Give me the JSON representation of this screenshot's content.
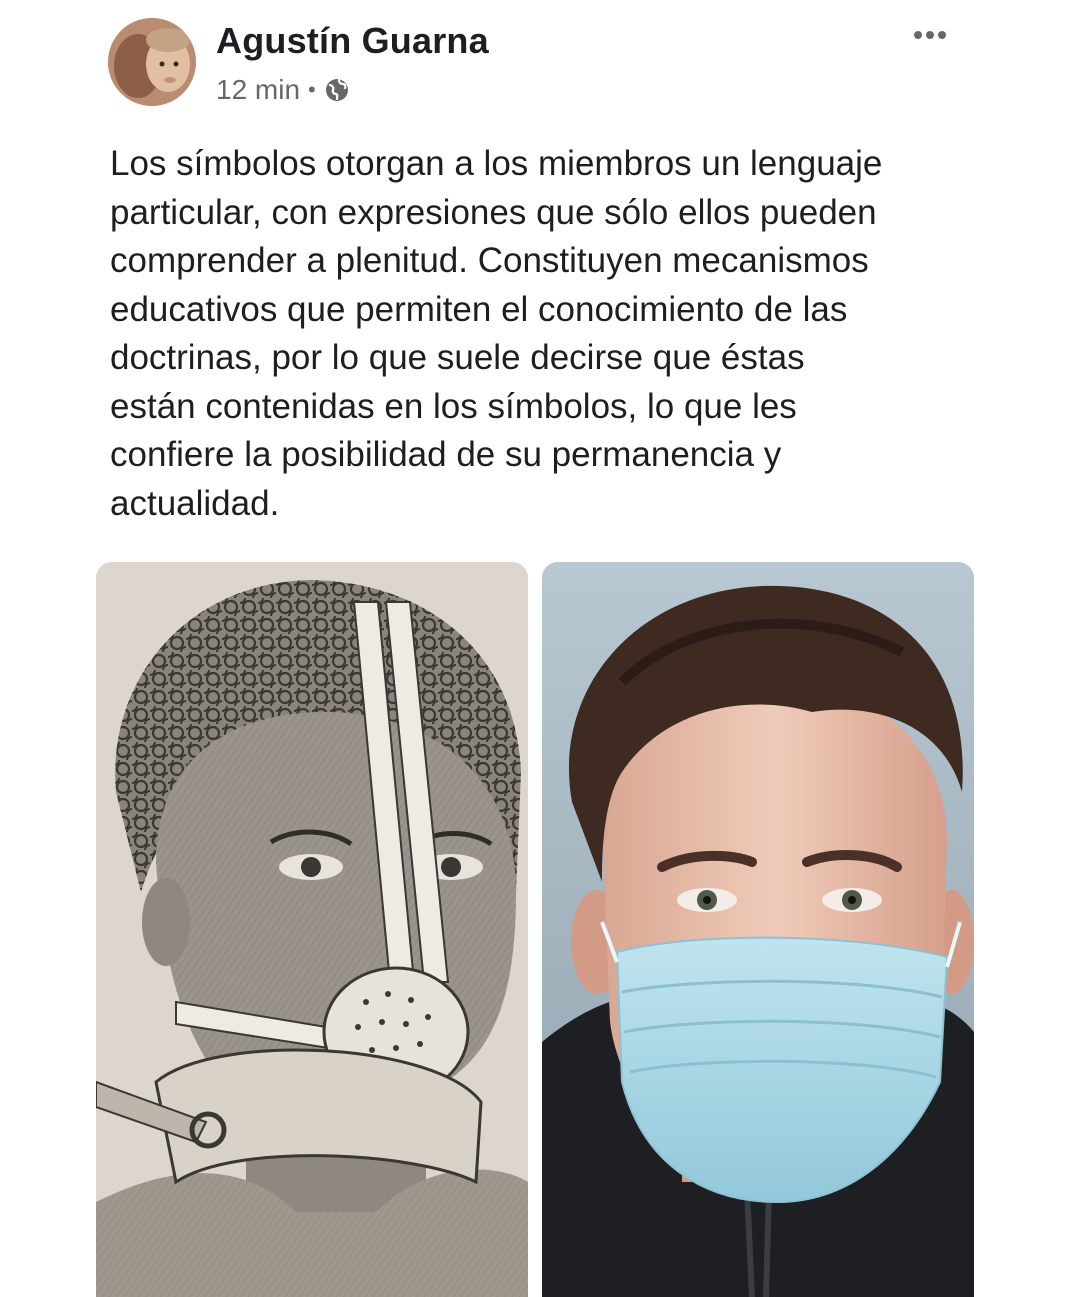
{
  "post": {
    "author": "Agustín Guarna",
    "time": "12 min",
    "separator": "•",
    "privacy_icon": "globe-icon",
    "more_icon": "more-options-icon",
    "text": "Los símbolos otorgan a los miembros un lenguaje\nparticular, con expresiones que sólo ellos pueden\ncomprender a plenitud. Constituyen mecanismos\neducativos que permiten el conocimiento de las\ndoctrinas, por lo que suele decirse que éstas\nestán contenidas en los símbolos, lo que les\nconfiere la posibilidad de su permanencia y\nactualidad."
  },
  "images": [
    {
      "name": "engraving-portrait-with-iron-mask"
    },
    {
      "name": "young-man-wearing-surgical-mask"
    }
  ],
  "colors": {
    "text_primary": "#1c1e21",
    "text_secondary": "#65676b",
    "mask_blue": "#a9d6e5"
  }
}
